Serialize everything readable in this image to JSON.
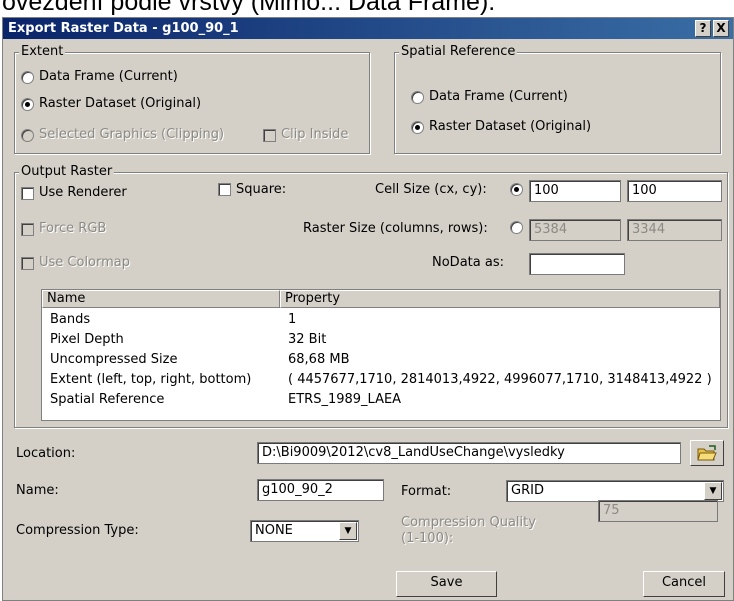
{
  "background_text": "ovezdění podle vrstvy (Mimo... Data Frame).",
  "window": {
    "title": "Export Raster Data - g100_90_1",
    "help_label": "?",
    "close_label": "X"
  },
  "extent": {
    "legend": "Extent",
    "options": [
      "Data Frame (Current)",
      "Raster Dataset (Original)",
      "Selected Graphics (Clipping)"
    ],
    "selected": "Raster Dataset (Original)",
    "clip_inside_label": "Clip Inside"
  },
  "spatial_reference": {
    "legend": "Spatial Reference",
    "options": [
      "Data Frame (Current)",
      "Raster Dataset (Original)"
    ],
    "selected": "Raster Dataset (Original)"
  },
  "output_raster": {
    "legend": "Output Raster",
    "use_renderer_label": "Use Renderer",
    "square_label": "Square:",
    "cell_size_label": "Cell Size (cx, cy):",
    "cell_size_x": "100",
    "cell_size_y": "100",
    "force_rgb_label": "Force RGB",
    "raster_size_label": "Raster Size (columns, rows):",
    "raster_columns": "5384",
    "raster_rows": "3344",
    "use_colormap_label": "Use Colormap",
    "nodata_label": "NoData as:",
    "nodata_value": ""
  },
  "properties_table": {
    "columns": [
      "Name",
      "Property"
    ],
    "rows": [
      [
        "Bands",
        "1"
      ],
      [
        "Pixel Depth",
        "32 Bit"
      ],
      [
        "Uncompressed Size",
        "68,68 MB"
      ],
      [
        "Extent (left, top, right, bottom)",
        "( 4457677,1710, 2814013,4922, 4996077,1710, 3148413,4922 )"
      ],
      [
        "Spatial Reference",
        "ETRS_1989_LAEA"
      ]
    ]
  },
  "location": {
    "label": "Location:",
    "value": "D:\\Bi9009\\2012\\cv8_LandUseChange\\vysledky"
  },
  "name": {
    "label": "Name:",
    "value": "g100_90_2"
  },
  "format": {
    "label": "Format:",
    "value": "GRID"
  },
  "compression_type": {
    "label": "Compression Type:",
    "value": "NONE"
  },
  "compression_quality": {
    "label_line1": "Compression Quality",
    "label_line2": "(1-100):",
    "value": "75"
  },
  "buttons": {
    "save": "Save",
    "cancel": "Cancel"
  }
}
